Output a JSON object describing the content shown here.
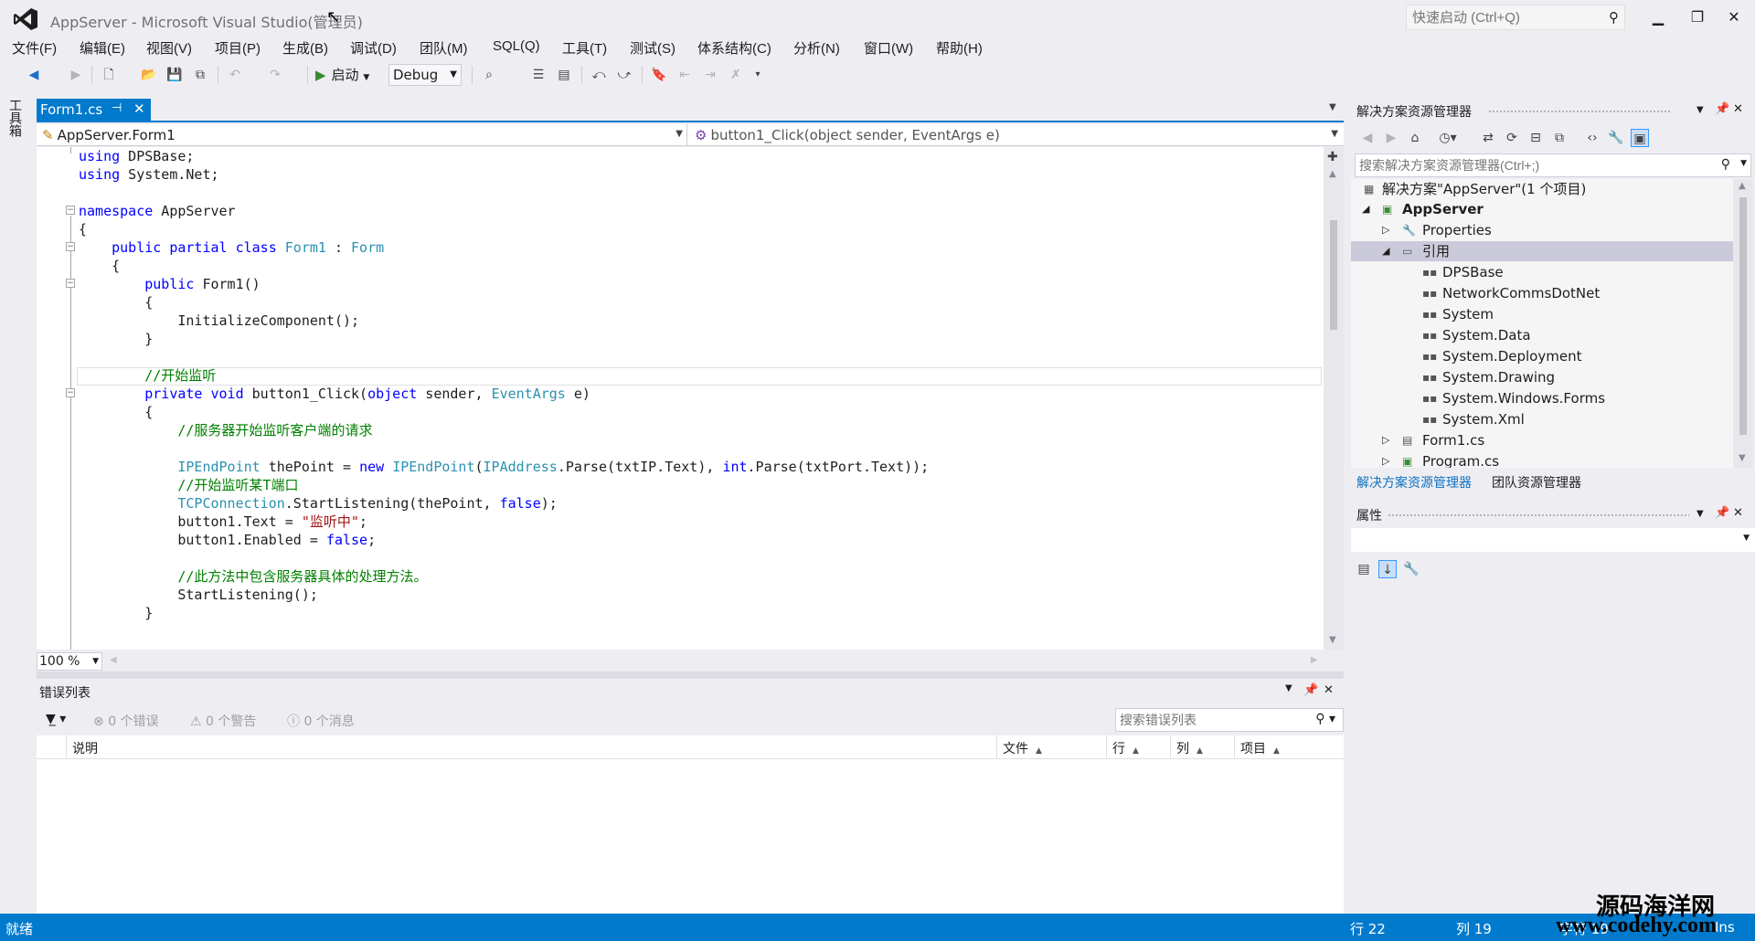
{
  "window": {
    "title": "AppServer - Microsoft Visual Studio(管理员)",
    "quick_launch_placeholder": "快速启动 (Ctrl+Q)"
  },
  "menu": [
    "文件(F)",
    "编辑(E)",
    "视图(V)",
    "项目(P)",
    "生成(B)",
    "调试(D)",
    "团队(M)",
    "SQL(Q)",
    "工具(T)",
    "测试(S)",
    "体系结构(C)",
    "分析(N)",
    "窗口(W)",
    "帮助(H)"
  ],
  "toolbar": {
    "start_label": "启动",
    "configuration": "Debug"
  },
  "toolbox_tab": "工具箱",
  "editor": {
    "tab_label": "Form1.cs",
    "nav_class": "AppServer.Form1",
    "nav_member": "button1_Click(object sender, EventArgs e)",
    "zoom": "100 %"
  },
  "error_list": {
    "title": "错误列表",
    "errors": "0 个错误",
    "warnings": "0 个警告",
    "messages": "0 个消息",
    "search_placeholder": "搜索错误列表",
    "columns": [
      "说明",
      "文件",
      "行",
      "列",
      "项目"
    ]
  },
  "solution_explorer": {
    "title": "解决方案资源管理器",
    "search_placeholder": "搜索解决方案资源管理器(Ctrl+;)",
    "tree": {
      "solution": "解决方案\"AppServer\"(1 个项目)",
      "project": "AppServer",
      "properties": "Properties",
      "references": "引用",
      "reference_items": [
        "DPSBase",
        "NetworkCommsDotNet",
        "System",
        "System.Data",
        "System.Deployment",
        "System.Drawing",
        "System.Windows.Forms",
        "System.Xml"
      ],
      "form1": "Form1.cs",
      "program": "Program.cs"
    },
    "tabs": [
      "解决方案资源管理器",
      "团队资源管理器"
    ]
  },
  "properties": {
    "title": "属性"
  },
  "status_bar": {
    "ready": "就绪",
    "line": "行 22",
    "col": "列 19",
    "char": "字符 19",
    "mode": "Ins"
  },
  "watermark": {
    "name": "源码海洋网",
    "url": "www.codehy.com"
  },
  "colors": {
    "accent": "#007acc",
    "keyword": "#0000ff",
    "type": "#2b91af",
    "comment": "#008000",
    "string": "#a31515"
  }
}
